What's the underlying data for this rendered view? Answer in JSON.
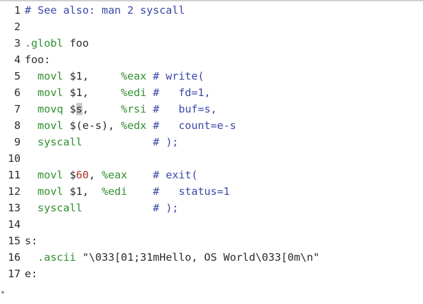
{
  "editor": {
    "lines": [
      {
        "n": "1",
        "parts": [
          {
            "t": "# See also: man 2 syscall",
            "c": "t-comment"
          }
        ]
      },
      {
        "n": "2",
        "parts": []
      },
      {
        "n": "3",
        "parts": [
          {
            "t": ".globl ",
            "c": "t-dir"
          },
          {
            "t": "foo",
            "c": "t-plain"
          }
        ]
      },
      {
        "n": "4",
        "parts": [
          {
            "t": "foo:",
            "c": "t-label"
          }
        ]
      },
      {
        "n": "5",
        "parts": [
          {
            "t": "  movl ",
            "c": "t-kw"
          },
          {
            "t": "$1,     ",
            "c": "t-plain"
          },
          {
            "t": "%eax",
            "c": "t-reg"
          },
          {
            "t": " # write(",
            "c": "t-comment"
          }
        ]
      },
      {
        "n": "6",
        "parts": [
          {
            "t": "  movl ",
            "c": "t-kw"
          },
          {
            "t": "$1,     ",
            "c": "t-plain"
          },
          {
            "t": "%edi",
            "c": "t-reg"
          },
          {
            "t": " #   fd=1,",
            "c": "t-comment"
          }
        ]
      },
      {
        "n": "7",
        "parts": [
          {
            "t": "  movq ",
            "c": "t-kw"
          },
          {
            "t": "$",
            "c": "t-plain"
          },
          {
            "t": "s",
            "c": "cursor"
          },
          {
            "t": ",     ",
            "c": "t-plain"
          },
          {
            "t": "%rsi",
            "c": "t-reg"
          },
          {
            "t": " #   buf=s,",
            "c": "t-comment"
          }
        ]
      },
      {
        "n": "8",
        "parts": [
          {
            "t": "  movl ",
            "c": "t-kw"
          },
          {
            "t": "$(e-s), ",
            "c": "t-plain"
          },
          {
            "t": "%edx",
            "c": "t-reg"
          },
          {
            "t": " #   count=e-s",
            "c": "t-comment"
          }
        ]
      },
      {
        "n": "9",
        "parts": [
          {
            "t": "  syscall",
            "c": "t-kw"
          },
          {
            "t": "           # );",
            "c": "t-comment"
          }
        ]
      },
      {
        "n": "10",
        "parts": []
      },
      {
        "n": "11",
        "parts": [
          {
            "t": "  movl ",
            "c": "t-kw"
          },
          {
            "t": "$",
            "c": "t-plain"
          },
          {
            "t": "60",
            "c": "t-num"
          },
          {
            "t": ", ",
            "c": "t-plain"
          },
          {
            "t": "%eax",
            "c": "t-reg"
          },
          {
            "t": "    # exit(",
            "c": "t-comment"
          }
        ]
      },
      {
        "n": "12",
        "parts": [
          {
            "t": "  movl ",
            "c": "t-kw"
          },
          {
            "t": "$1,  ",
            "c": "t-plain"
          },
          {
            "t": "%edi",
            "c": "t-reg"
          },
          {
            "t": "    #   status=1",
            "c": "t-comment"
          }
        ]
      },
      {
        "n": "13",
        "parts": [
          {
            "t": "  syscall",
            "c": "t-kw"
          },
          {
            "t": "           # );",
            "c": "t-comment"
          }
        ]
      },
      {
        "n": "14",
        "parts": []
      },
      {
        "n": "15",
        "parts": [
          {
            "t": "s:",
            "c": "t-label"
          }
        ]
      },
      {
        "n": "16",
        "parts": [
          {
            "t": "  .ascii ",
            "c": "t-dir"
          },
          {
            "t": "\"\\033[01;31mHello, OS World\\033[0m\\n\"",
            "c": "t-str"
          }
        ]
      },
      {
        "n": "17",
        "parts": [
          {
            "t": "e:",
            "c": "t-label"
          }
        ]
      }
    ]
  }
}
